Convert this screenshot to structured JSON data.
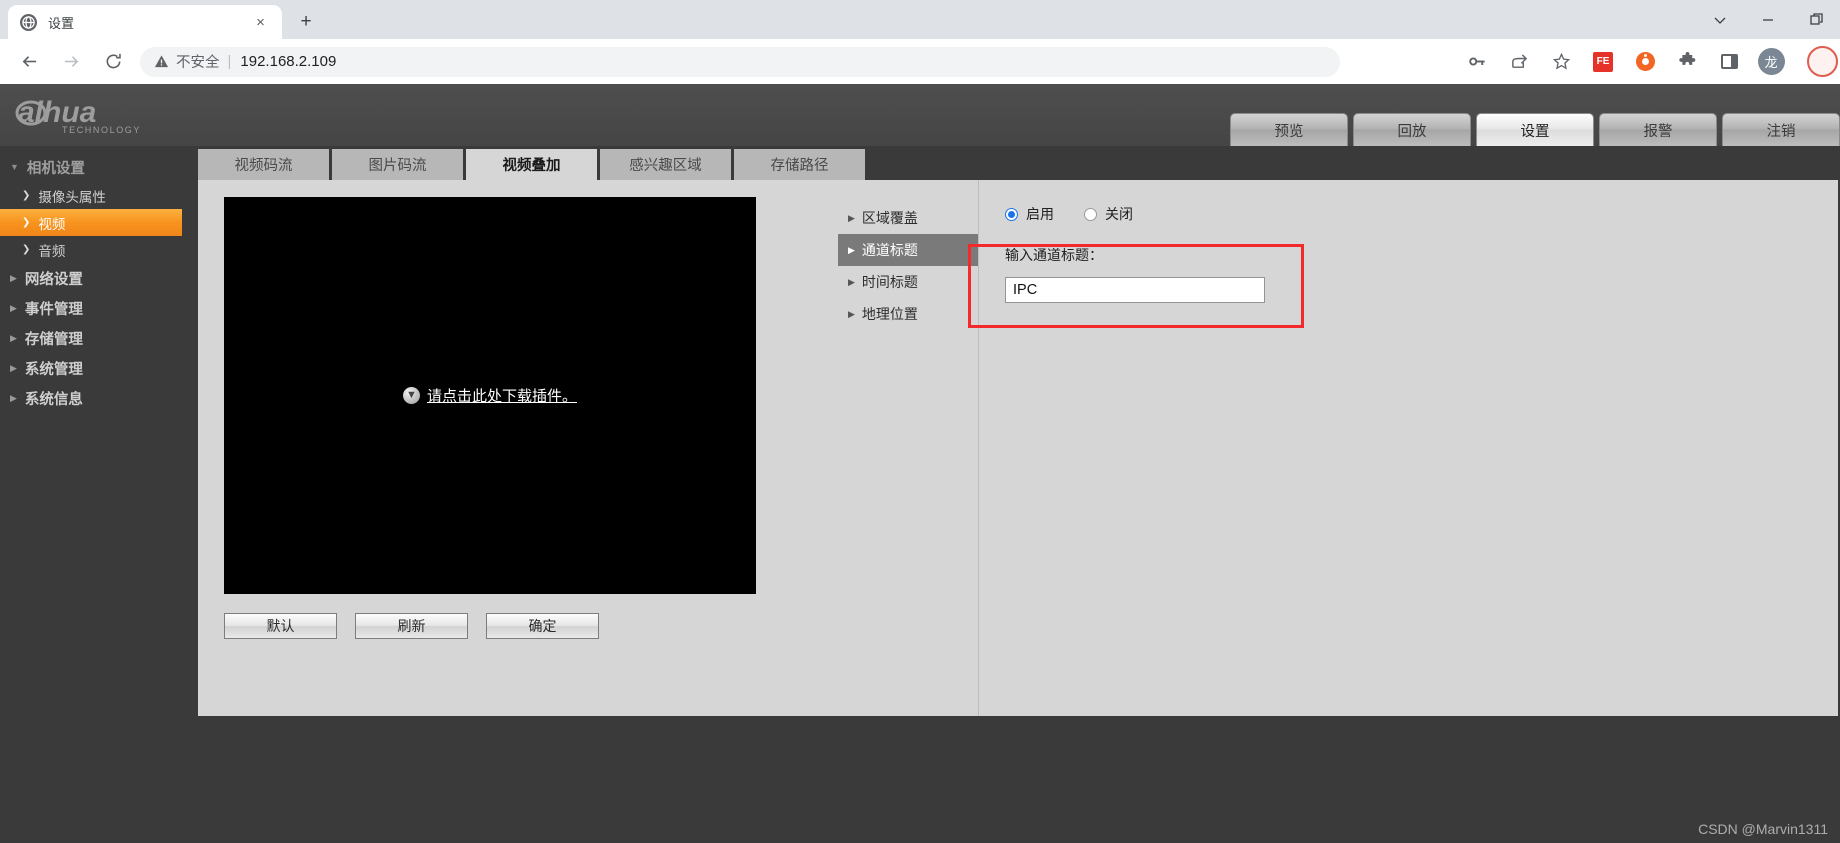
{
  "browser": {
    "tab": {
      "title": "设置",
      "favicon": "globe-icon",
      "close": "×"
    },
    "new_tab": "+",
    "window_controls": {
      "expand": "⌄",
      "minimize": "—",
      "maximize": "❐"
    },
    "nav": {
      "back": "←",
      "forward": "→",
      "reload": "⟳"
    },
    "omnibox": {
      "warning_icon": "warning-triangle-icon",
      "security_label": "不安全",
      "separator": "|",
      "url": "192.168.2.109"
    },
    "toolbar_icons": [
      {
        "name": "password-key-icon",
        "glyph": "⚷"
      },
      {
        "name": "share-icon",
        "glyph": "↗"
      },
      {
        "name": "bookmark-star-icon",
        "glyph": "☆"
      },
      {
        "name": "extension-fe-icon",
        "glyph": "FE"
      },
      {
        "name": "extension-orange-icon",
        "glyph": ""
      },
      {
        "name": "extensions-puzzle-icon",
        "glyph": "🧩"
      },
      {
        "name": "side-panel-icon",
        "glyph": ""
      },
      {
        "name": "profile-avatar-icon",
        "glyph": "龙"
      }
    ]
  },
  "header": {
    "logo_text": "alhua",
    "logo_subtext": "TECHNOLOGY",
    "topnav": [
      {
        "label": "预览",
        "active": false
      },
      {
        "label": "回放",
        "active": false
      },
      {
        "label": "设置",
        "active": true
      },
      {
        "label": "报警",
        "active": false
      },
      {
        "label": "注销",
        "active": false
      }
    ]
  },
  "sidebar": {
    "group": {
      "label": "相机设置",
      "caret": "▼"
    },
    "subitems": [
      {
        "label": "摄像头属性",
        "caret": "❯",
        "active": false
      },
      {
        "label": "视频",
        "caret": "❯",
        "active": true
      },
      {
        "label": "音频",
        "caret": "❯",
        "active": false
      }
    ],
    "topitems": [
      {
        "label": "网络设置",
        "caret": "▶"
      },
      {
        "label": "事件管理",
        "caret": "▶"
      },
      {
        "label": "存储管理",
        "caret": "▶"
      },
      {
        "label": "系统管理",
        "caret": "▶"
      },
      {
        "label": "系统信息",
        "caret": "▶"
      }
    ]
  },
  "content": {
    "tabs": [
      {
        "label": "视频码流",
        "active": false
      },
      {
        "label": "图片码流",
        "active": false
      },
      {
        "label": "视频叠加",
        "active": true
      },
      {
        "label": "感兴趣区域",
        "active": false
      },
      {
        "label": "存储路径",
        "active": false
      }
    ],
    "video": {
      "plugin_prompt": "请点击此处下载插件。",
      "download_icon": "download-arrow-icon"
    },
    "buttons": [
      {
        "label": "默认"
      },
      {
        "label": "刷新"
      },
      {
        "label": "确定"
      }
    ],
    "overlay_list": [
      {
        "label": "区域覆盖",
        "caret": "▶",
        "active": false
      },
      {
        "label": "通道标题",
        "caret": "▶",
        "active": true
      },
      {
        "label": "时间标题",
        "caret": "▶",
        "active": false
      },
      {
        "label": "地理位置",
        "caret": "▶",
        "active": false
      }
    ],
    "form": {
      "enable_label": "启用",
      "disable_label": "关闭",
      "enable_checked": true,
      "input_label": "输入通道标题：",
      "input_value": "IPC",
      "annotation_color": "#f3292b"
    }
  },
  "watermark": "CSDN @Marvin1311"
}
